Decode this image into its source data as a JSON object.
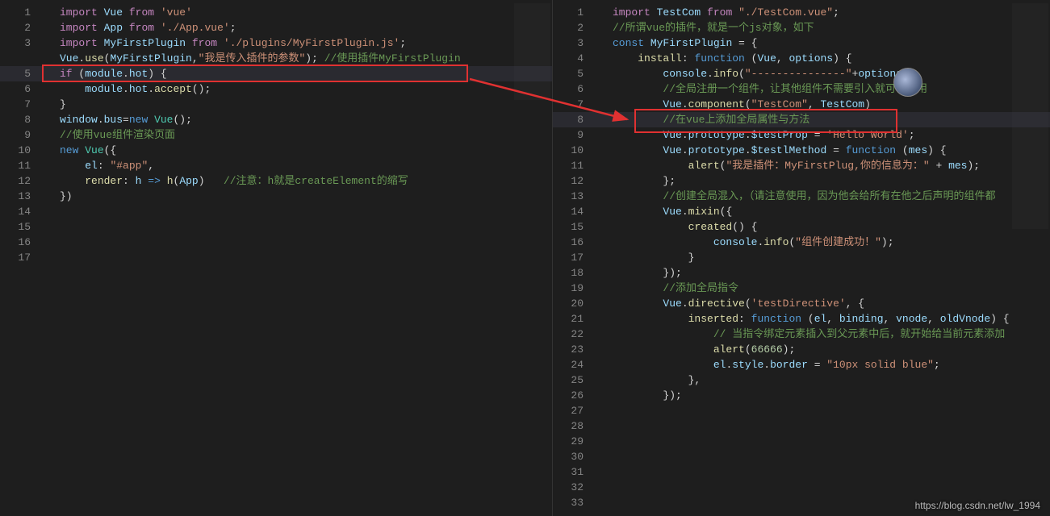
{
  "watermark": "https://blog.csdn.net/lw_1994",
  "left": {
    "numbers": [
      "1",
      "2",
      "3",
      "",
      "5",
      "6",
      "7",
      "8",
      "9",
      "10",
      "11",
      "12",
      "13",
      "14",
      "15",
      "16",
      "17"
    ],
    "lines": [
      [
        [
          "kw",
          "import"
        ],
        [
          "pun",
          " "
        ],
        [
          "var",
          "Vue"
        ],
        [
          "pun",
          " "
        ],
        [
          "kw",
          "from"
        ],
        [
          "pun",
          " "
        ],
        [
          "str",
          "'vue'"
        ]
      ],
      [
        [
          "kw",
          "import"
        ],
        [
          "pun",
          " "
        ],
        [
          "var",
          "App"
        ],
        [
          "pun",
          " "
        ],
        [
          "kw",
          "from"
        ],
        [
          "pun",
          " "
        ],
        [
          "str",
          "'./App.vue'"
        ],
        [
          "pun",
          ";"
        ]
      ],
      [
        [
          "kw",
          "import"
        ],
        [
          "pun",
          " "
        ],
        [
          "var",
          "MyFirstPlugin"
        ],
        [
          "pun",
          " "
        ],
        [
          "kw",
          "from"
        ],
        [
          "pun",
          " "
        ],
        [
          "str",
          "'./plugins/MyFirstPlugin.js'"
        ],
        [
          "pun",
          ";"
        ]
      ],
      [
        [
          "pun",
          ""
        ]
      ],
      [
        [
          "var",
          "Vue"
        ],
        [
          "pun",
          "."
        ],
        [
          "fn",
          "use"
        ],
        [
          "pun",
          "("
        ],
        [
          "var",
          "MyFirstPlugin"
        ],
        [
          "pun",
          ","
        ],
        [
          "str",
          "\"我是传入插件的参数\""
        ],
        [
          "pun",
          "); "
        ],
        [
          "cmt",
          "//使用插件MyFirstPlugin"
        ]
      ],
      [
        [
          "pun",
          ""
        ]
      ],
      [
        [
          "kw",
          "if"
        ],
        [
          "pun",
          " ("
        ],
        [
          "var",
          "module"
        ],
        [
          "pun",
          "."
        ],
        [
          "var",
          "hot"
        ],
        [
          "pun",
          ") {"
        ]
      ],
      [
        [
          "pun",
          "    "
        ],
        [
          "var",
          "module"
        ],
        [
          "pun",
          "."
        ],
        [
          "var",
          "hot"
        ],
        [
          "pun",
          "."
        ],
        [
          "fn",
          "accept"
        ],
        [
          "pun",
          "();"
        ]
      ],
      [
        [
          "pun",
          "}"
        ]
      ],
      [
        [
          "var",
          "window"
        ],
        [
          "pun",
          "."
        ],
        [
          "var",
          "bus"
        ],
        [
          "pun",
          "="
        ],
        [
          "blue",
          "new"
        ],
        [
          "pun",
          " "
        ],
        [
          "typ",
          "Vue"
        ],
        [
          "pun",
          "();"
        ]
      ],
      [
        [
          "cmt",
          "//使用vue组件渲染页面"
        ]
      ],
      [
        [
          "blue",
          "new"
        ],
        [
          "pun",
          " "
        ],
        [
          "typ",
          "Vue"
        ],
        [
          "pun",
          "({"
        ]
      ],
      [
        [
          "pun",
          "    "
        ],
        [
          "var",
          "el"
        ],
        [
          "pun",
          ": "
        ],
        [
          "str",
          "\"#app\""
        ],
        [
          "pun",
          ","
        ]
      ],
      [
        [
          "pun",
          "    "
        ],
        [
          "fn",
          "render"
        ],
        [
          "pun",
          ": "
        ],
        [
          "var",
          "h"
        ],
        [
          "pun",
          " "
        ],
        [
          "blue",
          "=>"
        ],
        [
          "pun",
          " "
        ],
        [
          "fn",
          "h"
        ],
        [
          "pun",
          "("
        ],
        [
          "var",
          "App"
        ],
        [
          "pun",
          ")   "
        ],
        [
          "cmt",
          "//注意：h就是createElement的缩写"
        ]
      ],
      [
        [
          "pun",
          "})"
        ]
      ],
      [
        [
          "pun",
          ""
        ]
      ],
      [
        [
          "pun",
          ""
        ]
      ]
    ]
  },
  "right": {
    "numbers": [
      "1",
      "2",
      "3",
      "4",
      "5",
      "6",
      "7",
      "8",
      "9",
      "10",
      "11",
      "12",
      "13",
      "14",
      "15",
      "16",
      "17",
      "18",
      "19",
      "20",
      "21",
      "22",
      "23",
      "24",
      "25",
      "26",
      "27",
      "28",
      "29",
      "30",
      "31",
      "32",
      "33"
    ],
    "lines": [
      [
        [
          "pun",
          ""
        ]
      ],
      [
        [
          "kw",
          "import"
        ],
        [
          "pun",
          " "
        ],
        [
          "var",
          "TestCom"
        ],
        [
          "pun",
          " "
        ],
        [
          "kw",
          "from"
        ],
        [
          "pun",
          " "
        ],
        [
          "str",
          "\"./TestCom.vue\""
        ],
        [
          "pun",
          ";"
        ]
      ],
      [
        [
          "pun",
          ""
        ]
      ],
      [
        [
          "cmt",
          "//所谓vue的插件，就是一个js对象，如下"
        ]
      ],
      [
        [
          "blue",
          "const"
        ],
        [
          "pun",
          " "
        ],
        [
          "var",
          "MyFirstPlugin"
        ],
        [
          "pun",
          " = {"
        ]
      ],
      [
        [
          "pun",
          "    "
        ],
        [
          "fn",
          "install"
        ],
        [
          "pun",
          ": "
        ],
        [
          "blue",
          "function"
        ],
        [
          "pun",
          " ("
        ],
        [
          "var",
          "Vue"
        ],
        [
          "pun",
          ", "
        ],
        [
          "var",
          "options"
        ],
        [
          "pun",
          ") {"
        ]
      ],
      [
        [
          "pun",
          ""
        ]
      ],
      [
        [
          "pun",
          "        "
        ],
        [
          "var",
          "console"
        ],
        [
          "pun",
          "."
        ],
        [
          "fn",
          "info"
        ],
        [
          "pun",
          "("
        ],
        [
          "str",
          "\"---------------\""
        ],
        [
          "pun",
          "+"
        ],
        [
          "var",
          "options"
        ],
        [
          "pun",
          ");"
        ]
      ],
      [
        [
          "pun",
          ""
        ]
      ],
      [
        [
          "pun",
          "        "
        ],
        [
          "cmt",
          "//全局注册一个组件，让其他组件不需要引入就可以调用"
        ]
      ],
      [
        [
          "pun",
          "        "
        ],
        [
          "var",
          "Vue"
        ],
        [
          "pun",
          "."
        ],
        [
          "fn",
          "component"
        ],
        [
          "pun",
          "("
        ],
        [
          "str",
          "\"TestCom\""
        ],
        [
          "pun",
          ", "
        ],
        [
          "var",
          "TestCom"
        ],
        [
          "pun",
          ")"
        ]
      ],
      [
        [
          "pun",
          ""
        ]
      ],
      [
        [
          "pun",
          "        "
        ],
        [
          "cmt",
          "//在vue上添加全局属性与方法"
        ]
      ],
      [
        [
          "pun",
          "        "
        ],
        [
          "var",
          "Vue"
        ],
        [
          "pun",
          "."
        ],
        [
          "var",
          "prototype"
        ],
        [
          "pun",
          "."
        ],
        [
          "var",
          "$testProp"
        ],
        [
          "pun",
          " = "
        ],
        [
          "str",
          "'Hello World'"
        ],
        [
          "pun",
          ";"
        ]
      ],
      [
        [
          "pun",
          "        "
        ],
        [
          "var",
          "Vue"
        ],
        [
          "pun",
          "."
        ],
        [
          "var",
          "prototype"
        ],
        [
          "pun",
          "."
        ],
        [
          "var",
          "$testlMethod"
        ],
        [
          "pun",
          " = "
        ],
        [
          "blue",
          "function"
        ],
        [
          "pun",
          " ("
        ],
        [
          "var",
          "mes"
        ],
        [
          "pun",
          ") {"
        ]
      ],
      [
        [
          "pun",
          "            "
        ],
        [
          "fn",
          "alert"
        ],
        [
          "pun",
          "("
        ],
        [
          "str",
          "\"我是插件：MyFirstPlug,你的信息为：\""
        ],
        [
          "pun",
          " + "
        ],
        [
          "var",
          "mes"
        ],
        [
          "pun",
          ");"
        ]
      ],
      [
        [
          "pun",
          "        };"
        ]
      ],
      [
        [
          "pun",
          ""
        ]
      ],
      [
        [
          "pun",
          "        "
        ],
        [
          "cmt",
          "//创建全局混入，（请注意使用，因为他会给所有在他之后声明的组件都"
        ]
      ],
      [
        [
          "pun",
          "        "
        ],
        [
          "var",
          "Vue"
        ],
        [
          "pun",
          "."
        ],
        [
          "fn",
          "mixin"
        ],
        [
          "pun",
          "({"
        ]
      ],
      [
        [
          "pun",
          "            "
        ],
        [
          "fn",
          "created"
        ],
        [
          "pun",
          "() {"
        ]
      ],
      [
        [
          "pun",
          "                "
        ],
        [
          "var",
          "console"
        ],
        [
          "pun",
          "."
        ],
        [
          "fn",
          "info"
        ],
        [
          "pun",
          "("
        ],
        [
          "str",
          "\"组件创建成功！\""
        ],
        [
          "pun",
          ");"
        ]
      ],
      [
        [
          "pun",
          "            }"
        ]
      ],
      [
        [
          "pun",
          "        });"
        ]
      ],
      [
        [
          "pun",
          ""
        ]
      ],
      [
        [
          "pun",
          "        "
        ],
        [
          "cmt",
          "//添加全局指令"
        ]
      ],
      [
        [
          "pun",
          "        "
        ],
        [
          "var",
          "Vue"
        ],
        [
          "pun",
          "."
        ],
        [
          "fn",
          "directive"
        ],
        [
          "pun",
          "("
        ],
        [
          "str",
          "'testDirective'"
        ],
        [
          "pun",
          ", {"
        ]
      ],
      [
        [
          "pun",
          "            "
        ],
        [
          "fn",
          "inserted"
        ],
        [
          "pun",
          ": "
        ],
        [
          "blue",
          "function"
        ],
        [
          "pun",
          " ("
        ],
        [
          "var",
          "el"
        ],
        [
          "pun",
          ", "
        ],
        [
          "var",
          "binding"
        ],
        [
          "pun",
          ", "
        ],
        [
          "var",
          "vnode"
        ],
        [
          "pun",
          ", "
        ],
        [
          "var",
          "oldVnode"
        ],
        [
          "pun",
          ") {"
        ]
      ],
      [
        [
          "pun",
          "                "
        ],
        [
          "cmt",
          "// 当指令绑定元素插入到父元素中后，就开始给当前元素添加"
        ]
      ],
      [
        [
          "pun",
          "                "
        ],
        [
          "fn",
          "alert"
        ],
        [
          "pun",
          "("
        ],
        [
          "num",
          "66666"
        ],
        [
          "pun",
          ");"
        ]
      ],
      [
        [
          "pun",
          "                "
        ],
        [
          "var",
          "el"
        ],
        [
          "pun",
          "."
        ],
        [
          "var",
          "style"
        ],
        [
          "pun",
          "."
        ],
        [
          "var",
          "border"
        ],
        [
          "pun",
          " = "
        ],
        [
          "str",
          "\"10px solid blue\""
        ],
        [
          "pun",
          ";"
        ]
      ],
      [
        [
          "pun",
          "            },"
        ]
      ],
      [
        [
          "pun",
          "        });"
        ]
      ]
    ]
  }
}
